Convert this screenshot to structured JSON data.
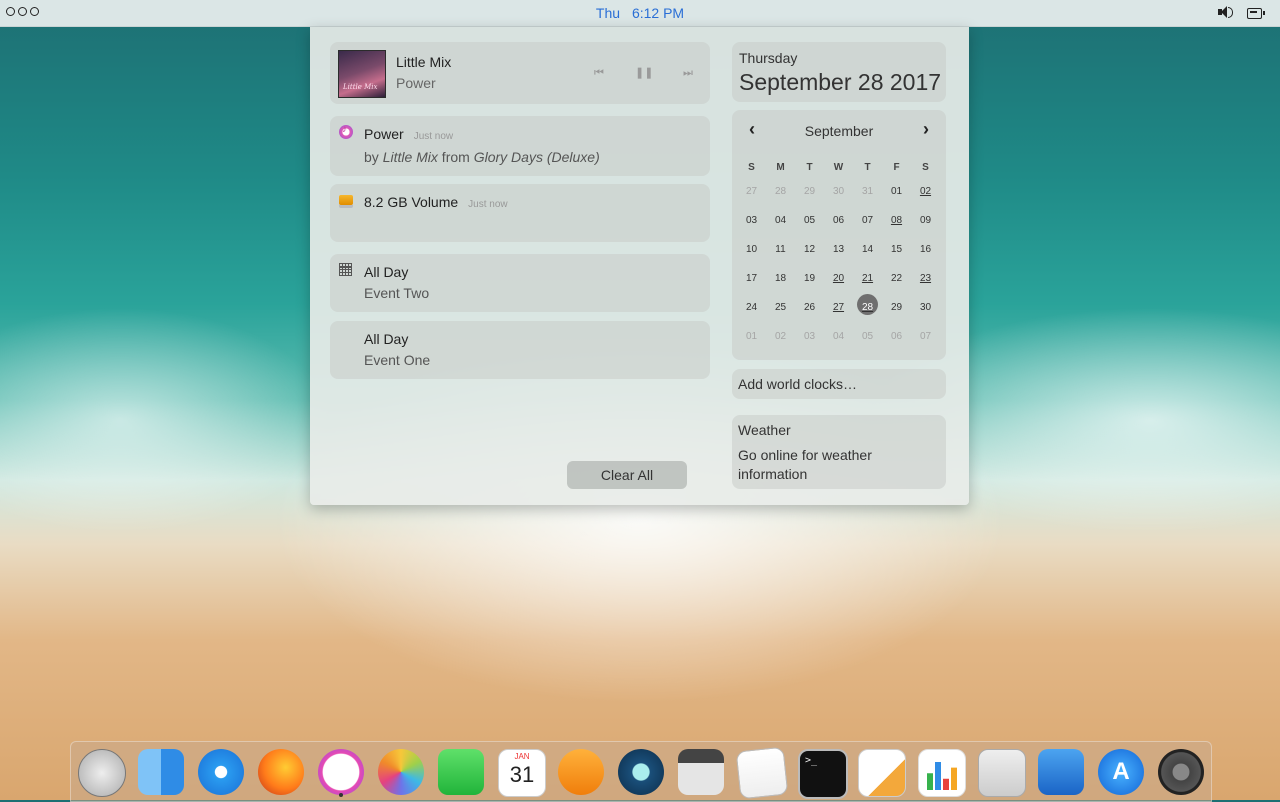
{
  "topbar": {
    "day": "Thu",
    "time": "6:12 PM"
  },
  "now_playing": {
    "artist": "Little Mix",
    "song": "Power"
  },
  "notifications": [
    {
      "icon": "music-note-icon",
      "title": "Power",
      "time": "Just now",
      "body_prefix": "by ",
      "body_artist": "Little Mix",
      "body_mid": " from ",
      "body_album": "Glory Days (Deluxe)"
    },
    {
      "icon": "drive-icon",
      "title": "8.2 GB Volume",
      "time": "Just now"
    },
    {
      "icon": "calendar-grid-icon",
      "title": "All Day",
      "body": "Event Two"
    },
    {
      "title": "All Day",
      "body": "Event One"
    }
  ],
  "clear_all_label": "Clear All",
  "date_widget": {
    "weekday": "Thursday",
    "date": "September 28 2017"
  },
  "calendar": {
    "month": "September",
    "weekdays": [
      "S",
      "M",
      "T",
      "W",
      "T",
      "F",
      "S"
    ],
    "weeks": [
      [
        {
          "d": "27",
          "m": 1
        },
        {
          "d": "28",
          "m": 1
        },
        {
          "d": "29",
          "m": 1
        },
        {
          "d": "30",
          "m": 1
        },
        {
          "d": "31",
          "m": 1
        },
        {
          "d": "01"
        },
        {
          "d": "02",
          "e": 1
        }
      ],
      [
        {
          "d": "03"
        },
        {
          "d": "04"
        },
        {
          "d": "05"
        },
        {
          "d": "06"
        },
        {
          "d": "07"
        },
        {
          "d": "08",
          "e": 1
        },
        {
          "d": "09"
        }
      ],
      [
        {
          "d": "10"
        },
        {
          "d": "11"
        },
        {
          "d": "12"
        },
        {
          "d": "13"
        },
        {
          "d": "14"
        },
        {
          "d": "15"
        },
        {
          "d": "16"
        }
      ],
      [
        {
          "d": "17"
        },
        {
          "d": "18"
        },
        {
          "d": "19"
        },
        {
          "d": "20",
          "e": 1
        },
        {
          "d": "21",
          "e": 1
        },
        {
          "d": "22"
        },
        {
          "d": "23",
          "e": 1
        }
      ],
      [
        {
          "d": "24"
        },
        {
          "d": "25"
        },
        {
          "d": "26"
        },
        {
          "d": "27",
          "e": 1
        },
        {
          "d": "28",
          "e": 1,
          "t": 1
        },
        {
          "d": "29"
        },
        {
          "d": "30"
        }
      ],
      [
        {
          "d": "01",
          "m": 1
        },
        {
          "d": "02",
          "m": 1
        },
        {
          "d": "03",
          "m": 1
        },
        {
          "d": "04",
          "m": 1
        },
        {
          "d": "05",
          "m": 1
        },
        {
          "d": "06",
          "m": 1
        },
        {
          "d": "07",
          "m": 1
        }
      ]
    ]
  },
  "world_clocks_label": "Add world clocks…",
  "weather": {
    "title": "Weather",
    "message": "Go online for weather information"
  },
  "dock": [
    {
      "name": "launcher-icon"
    },
    {
      "name": "finder-icon"
    },
    {
      "name": "safari-icon"
    },
    {
      "name": "firefox-icon"
    },
    {
      "name": "music-icon",
      "running": true
    },
    {
      "name": "photos-icon"
    },
    {
      "name": "facetime-icon"
    },
    {
      "name": "calendar-icon"
    },
    {
      "name": "vlc-icon"
    },
    {
      "name": "quicktime-icon"
    },
    {
      "name": "calculator-icon"
    },
    {
      "name": "textedit-icon"
    },
    {
      "name": "terminal-icon"
    },
    {
      "name": "pages-icon"
    },
    {
      "name": "numbers-icon"
    },
    {
      "name": "screenshot-icon"
    },
    {
      "name": "keynote-icon"
    },
    {
      "name": "appstore-icon"
    },
    {
      "name": "prefs-icon"
    }
  ]
}
